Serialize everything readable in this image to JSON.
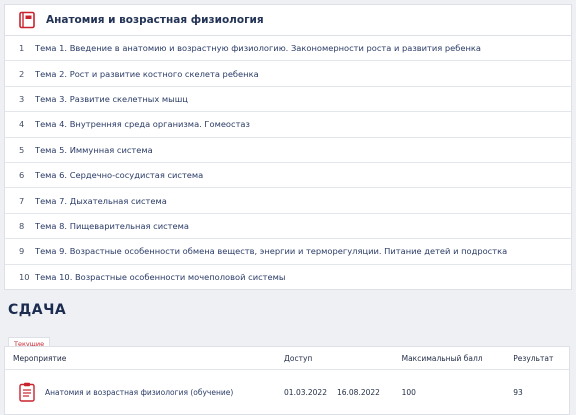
{
  "course": {
    "title": "Анатомия и возрастная физиология",
    "icon": "book-icon",
    "accent_color": "#c8242f",
    "topics": [
      {
        "num": "1",
        "label": "Тема 1. Введение в анатомию и возрастную физиологию. Закономерности роста и развития ребенка"
      },
      {
        "num": "2",
        "label": "Тема 2. Рост и развитие костного скелета ребенка"
      },
      {
        "num": "3",
        "label": "Тема 3. Развитие скелетных мышц"
      },
      {
        "num": "4",
        "label": "Тема 4. Внутренняя среда организма. Гомеостаз"
      },
      {
        "num": "5",
        "label": "Тема 5. Иммунная система"
      },
      {
        "num": "6",
        "label": "Тема 6. Сердечно-сосудистая система"
      },
      {
        "num": "7",
        "label": "Тема 7. Дыхательная система"
      },
      {
        "num": "8",
        "label": "Тема 8. Пищеварительная система"
      },
      {
        "num": "9",
        "label": "Тема 9. Возрастные особенности обмена веществ, энергии и терморегуляции. Питание детей и подростка"
      },
      {
        "num": "10",
        "label": "Тема 10. Возрастные особенности мочеполовой системы"
      }
    ]
  },
  "submission": {
    "title": "СДАЧА",
    "tab_current": "Текущие",
    "headers": {
      "event": "Мероприятие",
      "access": "Доступ",
      "max_score": "Максимальный балл",
      "result": "Результат"
    },
    "row": {
      "icon": "document-icon",
      "event": "Анатомия и возрастная физиология (обучение)",
      "access_from": "01.03.2022",
      "access_to": "16.08.2022",
      "max_score": "100",
      "result": "93"
    }
  }
}
